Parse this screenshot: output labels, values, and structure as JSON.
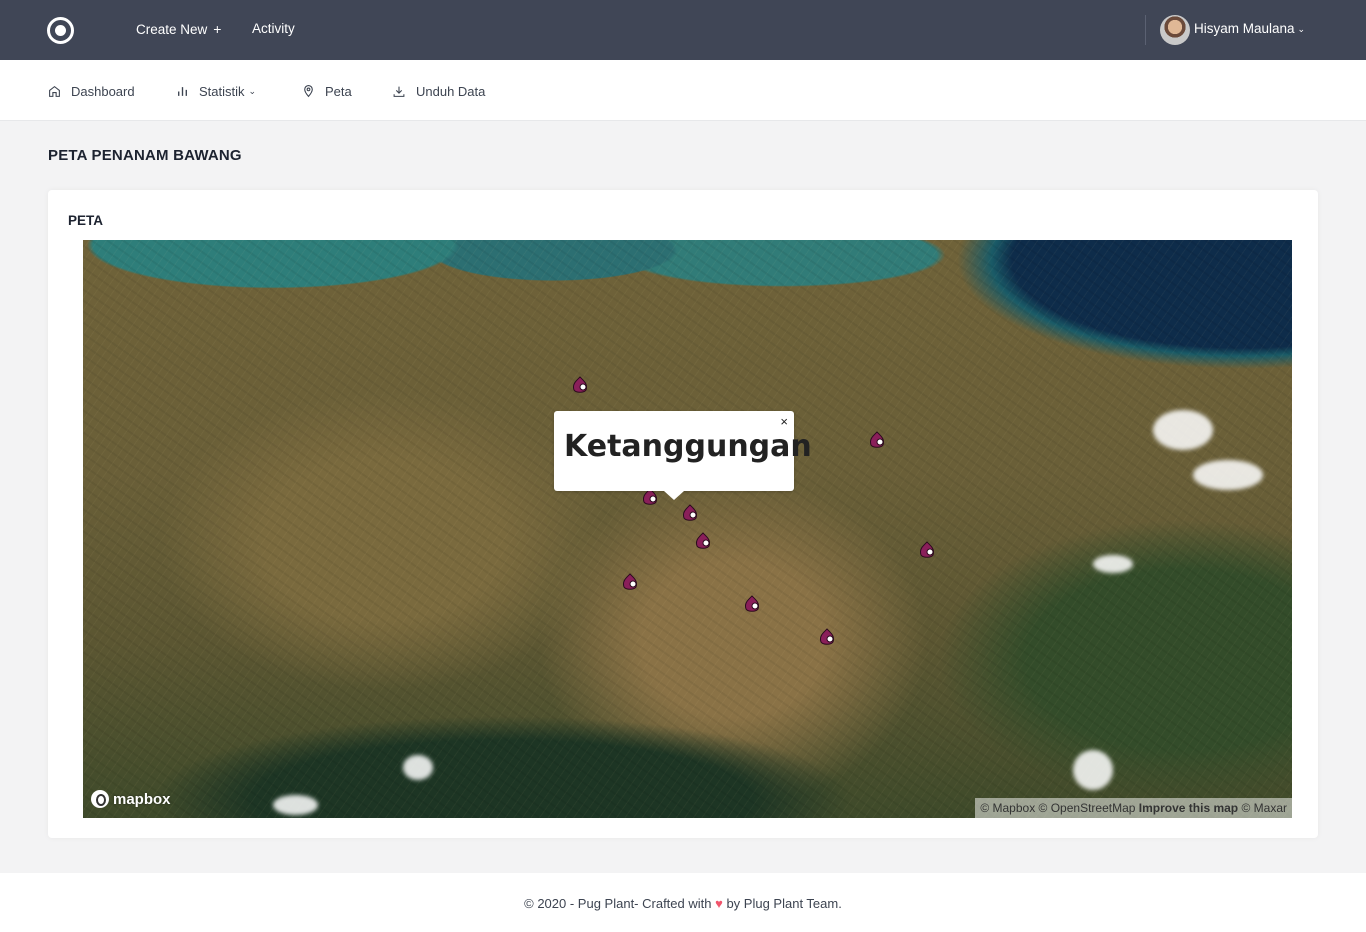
{
  "topbar": {
    "create_new": "Create New",
    "create_new_icon": "plus-icon",
    "activity": "Activity",
    "user_name": "Hisyam Maulana"
  },
  "nav": {
    "items": [
      {
        "label": "Dashboard",
        "icon": "home-icon"
      },
      {
        "label": "Statistik",
        "icon": "bar-chart-icon"
      },
      {
        "label": "Peta",
        "icon": "map-pin-icon"
      },
      {
        "label": "Unduh Data",
        "icon": "download-icon"
      }
    ]
  },
  "page": {
    "title": "PETA PENANAM BAWANG"
  },
  "card": {
    "title": "PETA"
  },
  "map": {
    "popup_text": "Ketanggungan",
    "popup_close": "×",
    "logo_text": "mapbox",
    "attribution": {
      "mapbox": "© Mapbox",
      "osm": "© OpenStreetMap",
      "improve": "Improve this map",
      "maxar": "© Maxar"
    },
    "marker_icon": "onion-icon",
    "marker_color": "#8a1f5a"
  },
  "footer": {
    "prefix": "© 2020 - Pug Plant- Crafted with",
    "heart": "♥",
    "suffix": "by Plug Plant Team."
  }
}
